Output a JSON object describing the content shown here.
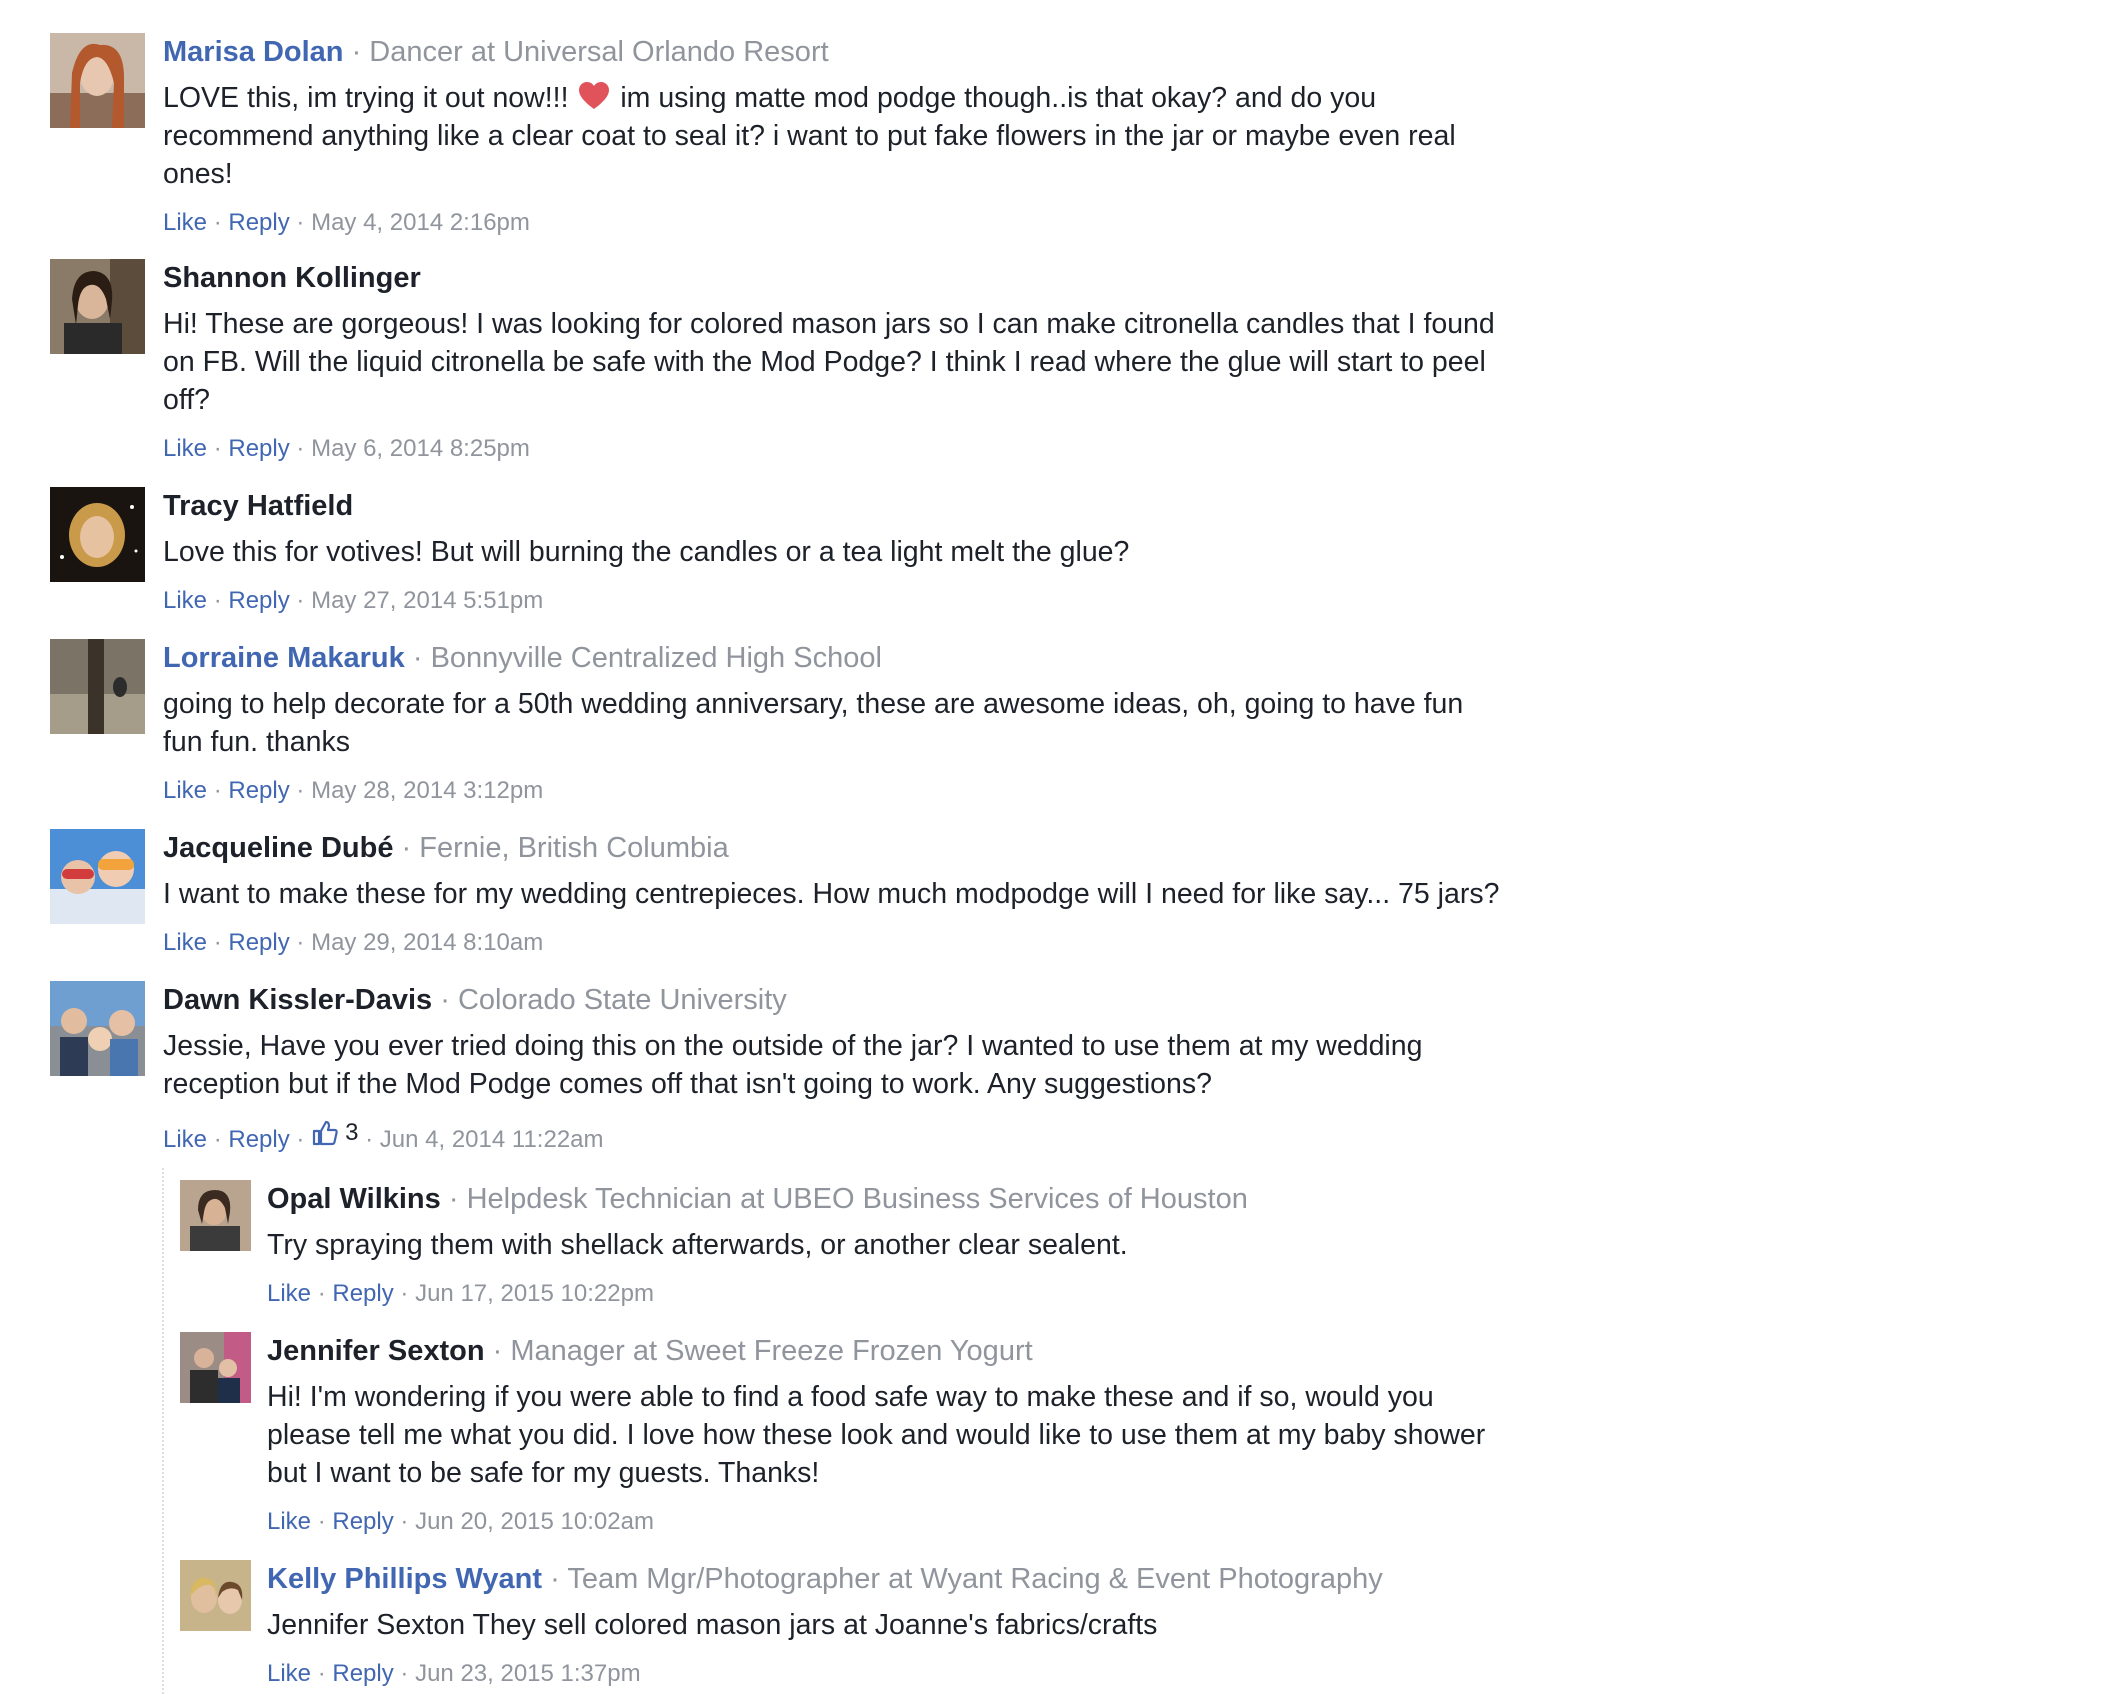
{
  "comments": [
    {
      "name": "Marisa Dolan",
      "subtitle": "Dancer at Universal Orlando Resort",
      "text_before": "LOVE this, im trying it out now!!!",
      "text_after": "im using matte mod podge though..is that okay? and do you recommend anything like a clear coat to seal it? i want to put fake flowers in the jar or maybe even real ones!",
      "emoji": "heart-emoji",
      "actions": {
        "like": "Like",
        "reply": "Reply",
        "timestamp": "May 4, 2014 2:16pm"
      }
    },
    {
      "name": "Shannon Kollinger",
      "text": "Hi! These are gorgeous! I was looking for colored mason jars so I can make citronella candles that I found on FB. Will the liquid citronella be safe with the Mod Podge? I think I read where the glue will start to peel off?",
      "actions": {
        "like": "Like",
        "reply": "Reply",
        "timestamp": "May 6, 2014 8:25pm"
      }
    },
    {
      "name": "Tracy Hatfield",
      "text": "Love this for votives! But will burning the candles or a tea light melt the glue?",
      "actions": {
        "like": "Like",
        "reply": "Reply",
        "timestamp": "May 27, 2014 5:51pm"
      }
    },
    {
      "name": "Lorraine Makaruk",
      "subtitle": "Bonnyville Centralized High School",
      "text": "going to help decorate for a 50th wedding anniversary, these are awesome ideas, oh, going to have fun fun fun. thanks",
      "actions": {
        "like": "Like",
        "reply": "Reply",
        "timestamp": "May 28, 2014 3:12pm"
      }
    },
    {
      "name": "Jacqueline Dubé",
      "subtitle": "Fernie, British Columbia",
      "text": "I want to make these for my wedding centrepieces. How much modpodge will I need for like say... 75 jars?",
      "actions": {
        "like": "Like",
        "reply": "Reply",
        "timestamp": "May 29, 2014 8:10am"
      }
    },
    {
      "name": "Dawn Kissler-Davis",
      "subtitle": "Colorado State University",
      "text": "Jessie, Have you ever tried doing this on the outside of the jar? I wanted to use them at my wedding reception but if the Mod Podge comes off that isn't going to work. Any suggestions?",
      "actions": {
        "like": "Like",
        "reply": "Reply",
        "like_count": "3",
        "like_icon": "thumbs-up-icon",
        "timestamp": "Jun 4, 2014 11:22am"
      }
    }
  ],
  "replies": [
    {
      "name": "Opal Wilkins",
      "subtitle": "Helpdesk Technician at UBEO Business Services of Houston",
      "text": "Try spraying them with shellack afterwards, or another clear sealent.",
      "actions": {
        "like": "Like",
        "reply": "Reply",
        "timestamp": "Jun 17, 2015 10:22pm"
      }
    },
    {
      "name": "Jennifer Sexton",
      "subtitle": "Manager at Sweet Freeze Frozen Yogurt",
      "text": "Hi! I'm wondering if you were able to find a food safe way to make these and if so, would you please tell me what you did. I love how these look and would like to use them at my baby shower but I want to be safe for my guests. Thanks!",
      "actions": {
        "like": "Like",
        "reply": "Reply",
        "timestamp": "Jun 20, 2015 10:02am"
      }
    },
    {
      "name": "Kelly Phillips Wyant",
      "subtitle": "Team Mgr/Photographer at Wyant Racing & Event Photography",
      "text": "Jennifer Sexton They sell colored mason jars at Joanne's fabrics/crafts",
      "actions": {
        "like": "Like",
        "reply": "Reply",
        "timestamp": "Jun 23, 2015 1:37pm"
      }
    }
  ],
  "separator": "·",
  "colors": {
    "link": "#4267b2",
    "meta": "#90949c",
    "text": "#1d2129"
  }
}
